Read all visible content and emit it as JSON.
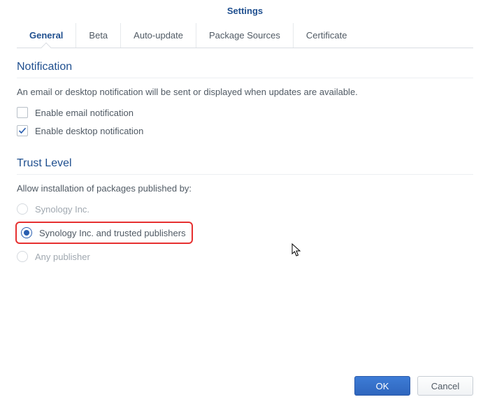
{
  "title": "Settings",
  "tabs": {
    "general": "General",
    "beta": "Beta",
    "auto_update": "Auto-update",
    "package_sources": "Package Sources",
    "certificate": "Certificate"
  },
  "active_tab": "general",
  "notification": {
    "title": "Notification",
    "desc": "An email or desktop notification will be sent or displayed when updates are available.",
    "email_label": "Enable email notification",
    "email_checked": false,
    "desktop_label": "Enable desktop notification",
    "desktop_checked": true
  },
  "trust": {
    "title": "Trust Level",
    "desc": "Allow installation of packages published by:",
    "options": {
      "synology": "Synology Inc.",
      "trusted": "Synology Inc. and trusted publishers",
      "any": "Any publisher"
    },
    "selected": "trusted"
  },
  "footer": {
    "ok": "OK",
    "cancel": "Cancel"
  }
}
